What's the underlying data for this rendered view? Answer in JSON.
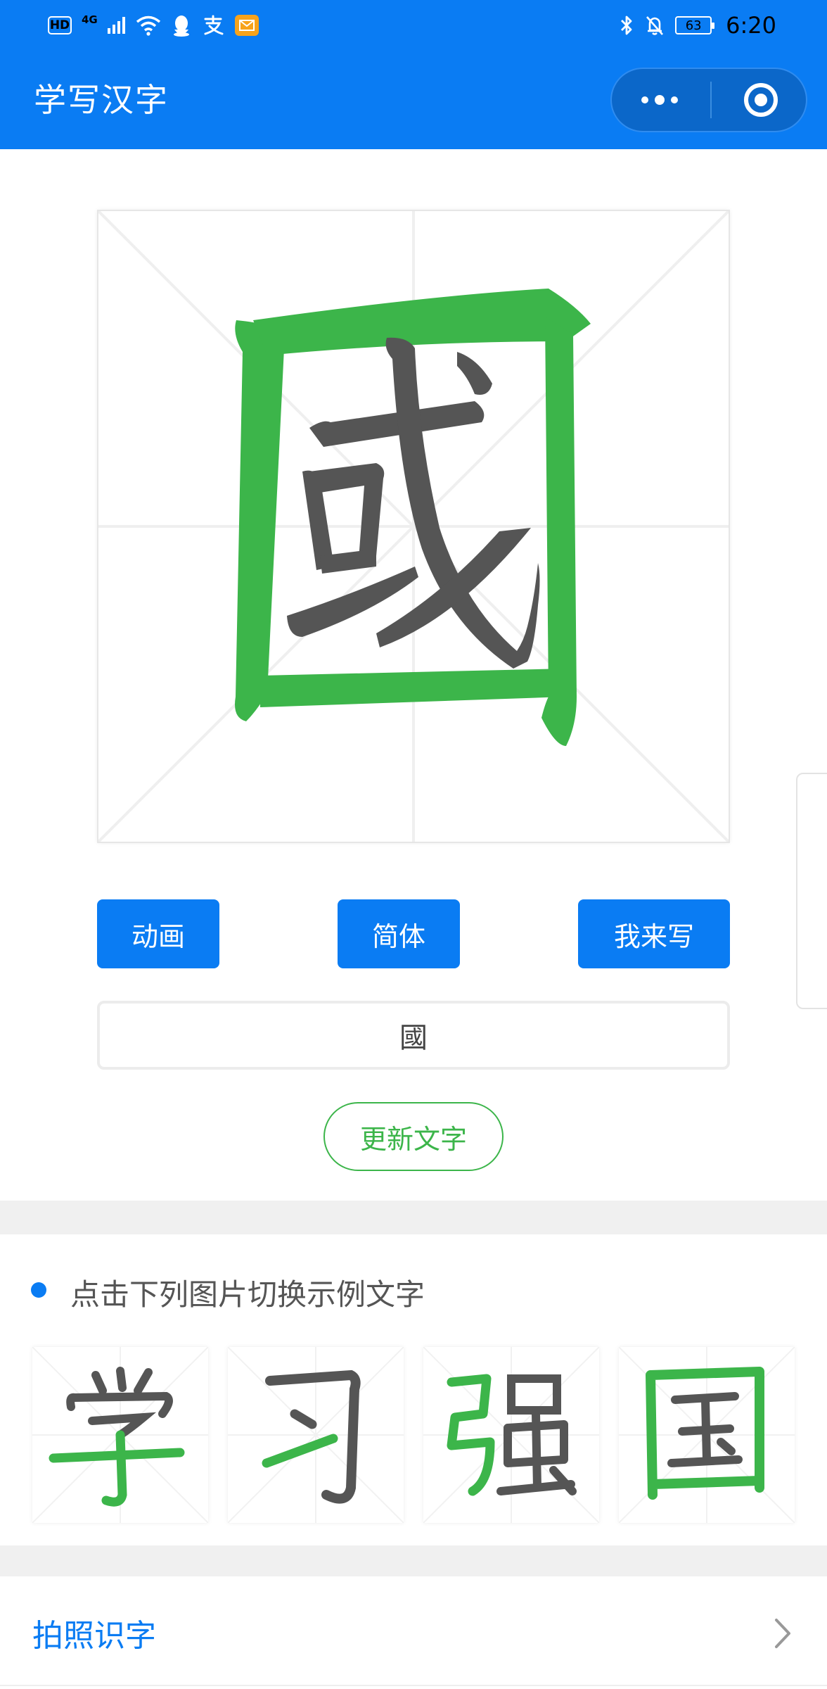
{
  "status_bar": {
    "hd": "HD",
    "network": "4G",
    "icons_left": [
      "signal-icon",
      "wifi-icon",
      "qq-icon",
      "alipay-icon",
      "mail-icon"
    ],
    "icons_right": [
      "bluetooth-icon",
      "mute-bell-icon",
      "battery-icon"
    ],
    "battery": "63",
    "time": "6:20"
  },
  "nav": {
    "title": "学写汉字",
    "capsule_icons": [
      "more-icon",
      "close-target-icon"
    ]
  },
  "colors": {
    "brand_blue": "#0a7cf3",
    "stroke_green": "#3cb54a",
    "stroke_gray": "#555555",
    "band_gray": "#f0f0f0"
  },
  "main": {
    "current_char": "國",
    "buttons": {
      "animate": "动画",
      "simplified": "简体",
      "write": "我来写"
    },
    "input_value": "國",
    "update_button": "更新文字"
  },
  "examples": {
    "title": "点击下列图片切换示例文字",
    "chars": [
      "学",
      "习",
      "强",
      "国"
    ]
  },
  "photo_row": {
    "label": "拍照识字"
  }
}
